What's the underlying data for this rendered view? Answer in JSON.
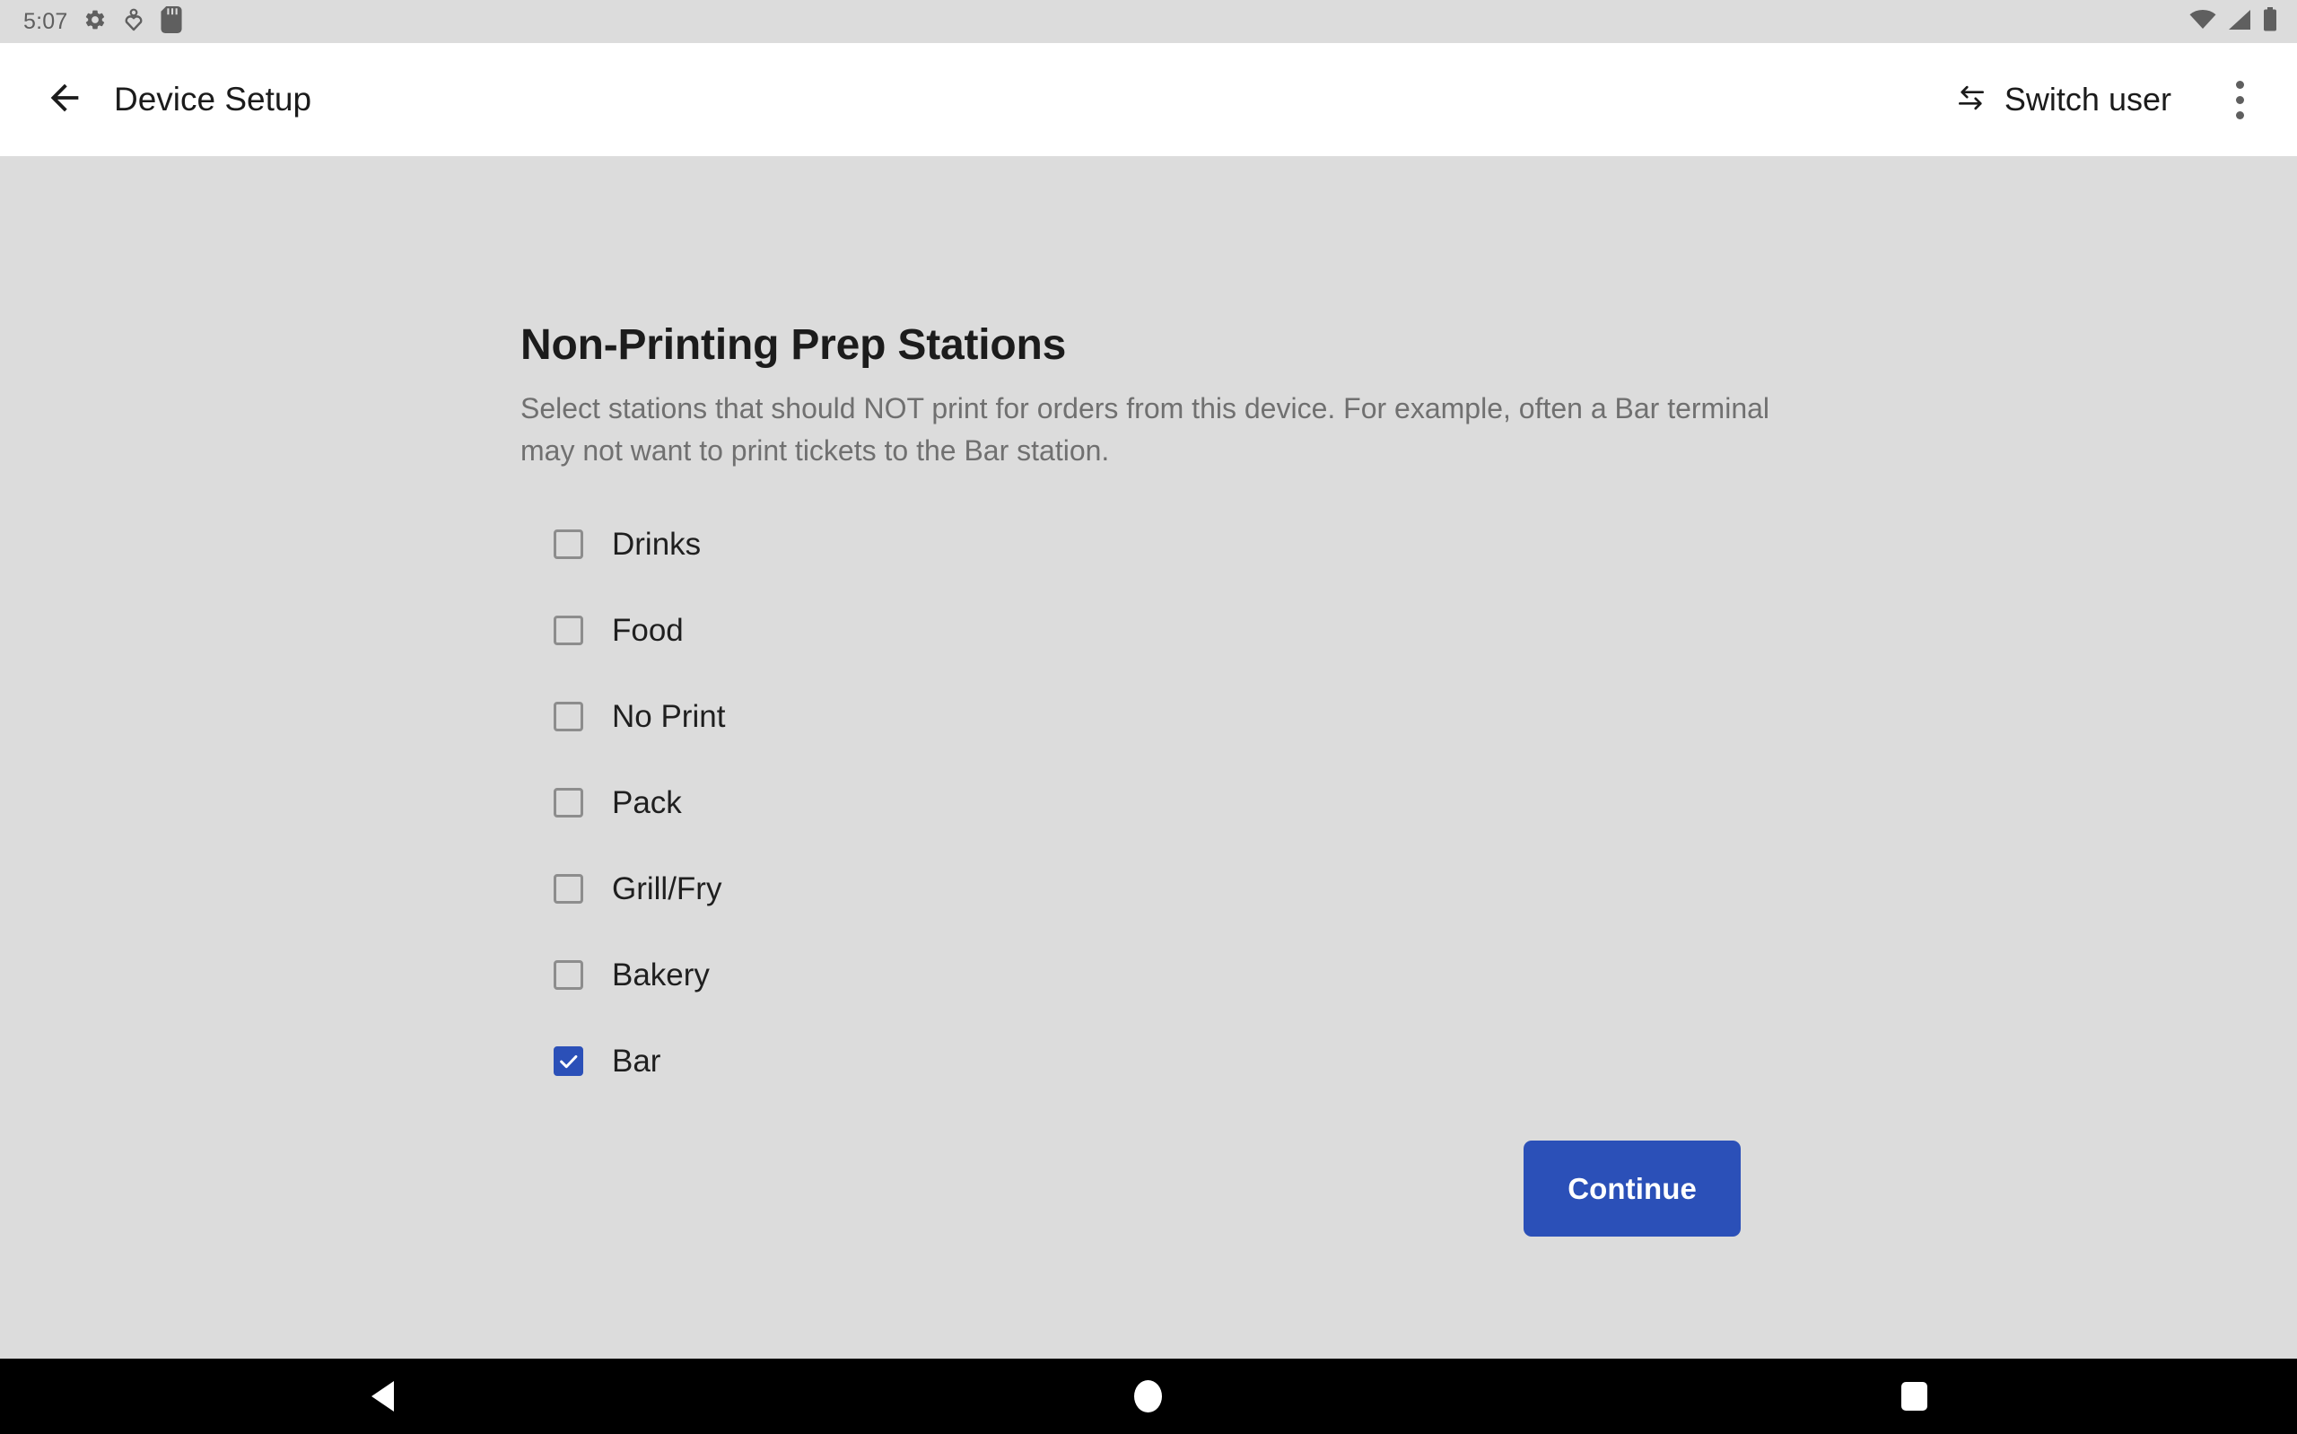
{
  "status_bar": {
    "clock": "5:07",
    "left_icons": [
      "settings-gear-icon",
      "dnd-heart-icon",
      "sd-card-icon"
    ],
    "right_icons": [
      "wifi-icon",
      "cell-signal-icon",
      "battery-icon"
    ],
    "background_color": "#dcdcdc",
    "icon_color": "#5f5f5f"
  },
  "app_bar": {
    "back_icon": "arrow-back-icon",
    "title": "Device Setup",
    "switch_user_label": "Switch user",
    "switch_user_icon": "swap-horizontal-icon",
    "overflow_icon": "more-vertical-icon",
    "background_color": "#ffffff"
  },
  "main": {
    "heading": "Non-Printing Prep Stations",
    "description": "Select stations that should NOT print for orders from this device. For example, often a Bar terminal may not want to print tickets to the Bar station.",
    "stations": [
      {
        "label": "Drinks",
        "checked": false
      },
      {
        "label": "Food",
        "checked": false
      },
      {
        "label": "No Print",
        "checked": false
      },
      {
        "label": "Pack",
        "checked": false
      },
      {
        "label": "Grill/Fry",
        "checked": false
      },
      {
        "label": "Bakery",
        "checked": false
      },
      {
        "label": "Bar",
        "checked": true
      }
    ],
    "continue_label": "Continue",
    "accent_color": "#2b50b8",
    "background_color": "#dcdcdc",
    "description_color": "#707070"
  },
  "nav_bar": {
    "background_color": "#000000",
    "buttons": [
      {
        "name": "nav-back-button",
        "icon": "triangle-back-icon"
      },
      {
        "name": "nav-home-button",
        "icon": "circle-home-icon"
      },
      {
        "name": "nav-recents-button",
        "icon": "square-recents-icon"
      }
    ]
  }
}
